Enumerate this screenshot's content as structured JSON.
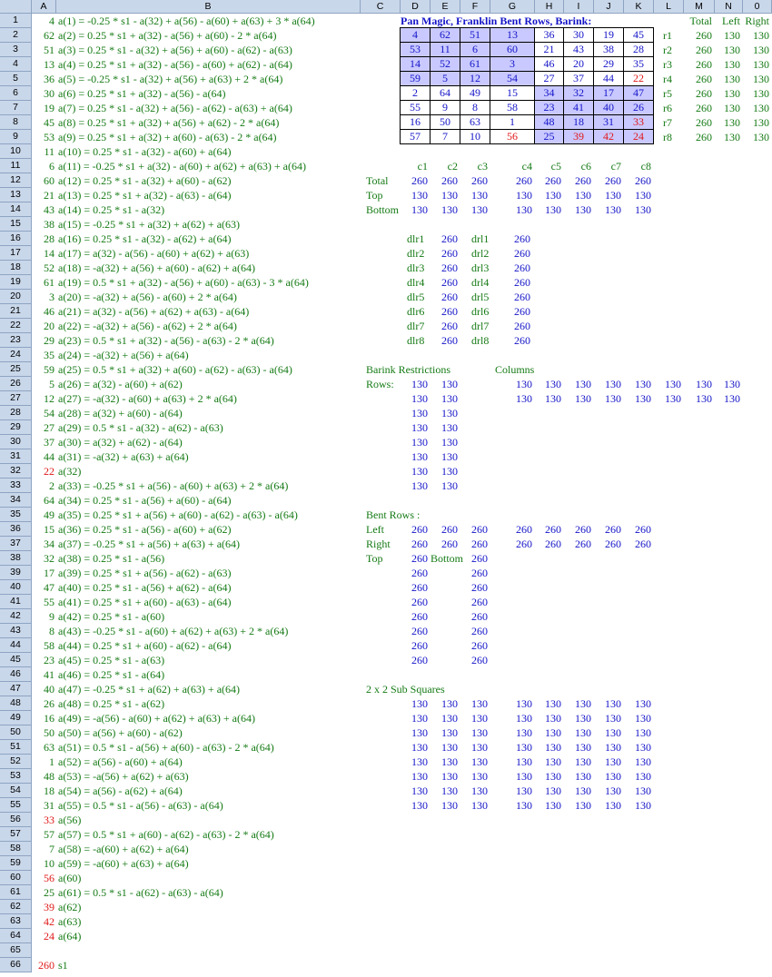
{
  "columns": [
    "A",
    "B",
    "C",
    "D",
    "E",
    "F",
    "G",
    "H",
    "I",
    "J",
    "K",
    "L",
    "M",
    "N",
    "0"
  ],
  "title": "Pan Magic, Franklin Bent Rows, Barink:",
  "hdr_total": "Total",
  "hdr_left": "Left",
  "hdr_right": "Right",
  "square": [
    [
      4,
      62,
      51,
      13,
      36,
      30,
      19,
      45
    ],
    [
      53,
      11,
      6,
      60,
      21,
      43,
      38,
      28
    ],
    [
      14,
      52,
      61,
      3,
      46,
      20,
      29,
      35
    ],
    [
      59,
      5,
      12,
      54,
      27,
      37,
      44,
      22
    ],
    [
      2,
      64,
      49,
      15,
      34,
      32,
      17,
      47
    ],
    [
      55,
      9,
      8,
      58,
      23,
      41,
      40,
      26
    ],
    [
      16,
      50,
      63,
      1,
      48,
      18,
      31,
      33
    ],
    [
      57,
      7,
      10,
      56,
      25,
      39,
      42,
      24
    ]
  ],
  "square_red": [
    [
      3,
      7
    ],
    [
      6,
      7
    ],
    [
      7,
      3
    ],
    [
      7,
      5
    ],
    [
      7,
      6
    ],
    [
      7,
      7
    ]
  ],
  "square_shaded": [
    [
      0,
      0
    ],
    [
      0,
      1
    ],
    [
      0,
      2
    ],
    [
      0,
      3
    ],
    [
      1,
      0
    ],
    [
      1,
      1
    ],
    [
      1,
      2
    ],
    [
      1,
      3
    ],
    [
      2,
      0
    ],
    [
      2,
      1
    ],
    [
      2,
      2
    ],
    [
      2,
      3
    ],
    [
      3,
      0
    ],
    [
      3,
      1
    ],
    [
      3,
      2
    ],
    [
      3,
      3
    ],
    [
      4,
      4
    ],
    [
      4,
      5
    ],
    [
      4,
      6
    ],
    [
      4,
      7
    ],
    [
      5,
      4
    ],
    [
      5,
      5
    ],
    [
      5,
      6
    ],
    [
      5,
      7
    ],
    [
      6,
      4
    ],
    [
      6,
      5
    ],
    [
      6,
      6
    ],
    [
      6,
      7
    ],
    [
      7,
      4
    ],
    [
      7,
      5
    ],
    [
      7,
      6
    ],
    [
      7,
      7
    ]
  ],
  "row_labels": [
    "r1",
    "r2",
    "r3",
    "r4",
    "r5",
    "r6",
    "r7",
    "r8"
  ],
  "row_totals": [
    [
      260,
      130,
      130
    ],
    [
      260,
      130,
      130
    ],
    [
      260,
      130,
      130
    ],
    [
      260,
      130,
      130
    ],
    [
      260,
      130,
      130
    ],
    [
      260,
      130,
      130
    ],
    [
      260,
      130,
      130
    ],
    [
      260,
      130,
      130
    ]
  ],
  "col_labels": [
    "c1",
    "c2",
    "c3",
    "c4",
    "c5",
    "c6",
    "c7",
    "c8"
  ],
  "col_rows": [
    {
      "label": "Total",
      "values": [
        260,
        260,
        260,
        260,
        260,
        260,
        260,
        260
      ]
    },
    {
      "label": "Top",
      "values": [
        130,
        130,
        130,
        130,
        130,
        130,
        130,
        130
      ]
    },
    {
      "label": "Bottom",
      "values": [
        130,
        130,
        130,
        130,
        130,
        130,
        130,
        130
      ]
    }
  ],
  "diagonals": [
    [
      "dlr1",
      260,
      "drl1",
      260
    ],
    [
      "dlr2",
      260,
      "drl2",
      260
    ],
    [
      "dlr3",
      260,
      "drl3",
      260
    ],
    [
      "dlr4",
      260,
      "drl4",
      260
    ],
    [
      "dlr5",
      260,
      "drl5",
      260
    ],
    [
      "dlr6",
      260,
      "drl6",
      260
    ],
    [
      "dlr7",
      260,
      "drl7",
      260
    ],
    [
      "dlr8",
      260,
      "drl8",
      260
    ]
  ],
  "barink_title": "Barink Restrictions",
  "barink_columns_title": "Columns",
  "barink_rows_label": "Rows:",
  "barink_rows": [
    [
      130,
      130
    ],
    [
      130,
      130
    ],
    [
      130,
      130
    ],
    [
      130,
      130
    ],
    [
      130,
      130
    ],
    [
      130,
      130
    ],
    [
      130,
      130
    ],
    [
      130,
      130
    ]
  ],
  "barink_cols": [
    [
      130,
      130,
      130,
      130,
      130,
      130,
      130,
      130
    ],
    [
      130,
      130,
      130,
      130,
      130,
      130,
      130,
      130
    ]
  ],
  "bent_title": "Bent Rows :",
  "bent_left_label": "Left",
  "bent_left": [
    260,
    260,
    260,
    260,
    260,
    260,
    260,
    260
  ],
  "bent_right_label": "Right",
  "bent_right": [
    260,
    260,
    260,
    260,
    260,
    260,
    260,
    260
  ],
  "bent_top_label": "Top",
  "bent_bottom_label": "Bottom",
  "bent_top": [
    260,
    260,
    260,
    260,
    260,
    260,
    260,
    260
  ],
  "bent_bottom": [
    260,
    260,
    260,
    260,
    260,
    260,
    260,
    260
  ],
  "sub_title": "2 x 2 Sub Squares",
  "sub_squares": [
    [
      130,
      130,
      130,
      130,
      130,
      130,
      130,
      130
    ],
    [
      130,
      130,
      130,
      130,
      130,
      130,
      130,
      130
    ],
    [
      130,
      130,
      130,
      130,
      130,
      130,
      130,
      130
    ],
    [
      130,
      130,
      130,
      130,
      130,
      130,
      130,
      130
    ],
    [
      130,
      130,
      130,
      130,
      130,
      130,
      130,
      130
    ],
    [
      130,
      130,
      130,
      130,
      130,
      130,
      130,
      130
    ],
    [
      130,
      130,
      130,
      130,
      130,
      130,
      130,
      130
    ],
    [
      130,
      130,
      130,
      130,
      130,
      130,
      130,
      130
    ]
  ],
  "colA": [
    {
      "v": "4",
      "f": "a(1) = -0.25 * s1 - a(32) + a(56) - a(60) + a(63) + 3 * a(64)"
    },
    {
      "v": "62",
      "f": "a(2) = 0.25 * s1 + a(32) - a(56) + a(60) - 2 * a(64)"
    },
    {
      "v": "51",
      "f": "a(3) = 0.25 * s1 - a(32) + a(56) + a(60) - a(62) - a(63)"
    },
    {
      "v": "13",
      "f": "a(4) = 0.25 * s1 + a(32) - a(56) - a(60) + a(62) - a(64)"
    },
    {
      "v": "36",
      "f": "a(5) = -0.25 * s1 - a(32) + a(56) + a(63) + 2 * a(64)"
    },
    {
      "v": "30",
      "f": "a(6) = 0.25 * s1 + a(32) - a(56) - a(64)"
    },
    {
      "v": "19",
      "f": "a(7) = 0.25 * s1 - a(32) + a(56) - a(62) - a(63) + a(64)"
    },
    {
      "v": "45",
      "f": "a(8) = 0.25 * s1 + a(32) + a(56) + a(62) - 2 * a(64)"
    },
    {
      "v": "53",
      "f": "a(9) = 0.25 * s1 + a(32) + a(60) - a(63) - 2 * a(64)"
    },
    {
      "v": "11",
      "f": "a(10) = 0.25 * s1 - a(32) - a(60) + a(64)"
    },
    {
      "v": "6",
      "f": "a(11) = -0.25 * s1 + a(32) - a(60) + a(62) + a(63) + a(64)"
    },
    {
      "v": "60",
      "f": "a(12) = 0.25 * s1 - a(32) + a(60) - a(62)"
    },
    {
      "v": "21",
      "f": "a(13) = 0.25 * s1 + a(32) - a(63) - a(64)"
    },
    {
      "v": "43",
      "f": "a(14) = 0.25 * s1 - a(32)"
    },
    {
      "v": "38",
      "f": "a(15) = -0.25 * s1 + a(32) + a(62) + a(63)"
    },
    {
      "v": "28",
      "f": "a(16) = 0.25 * s1 - a(32) - a(62) + a(64)"
    },
    {
      "v": "14",
      "f": "a(17) = a(32) - a(56) - a(60) + a(62) + a(63)"
    },
    {
      "v": "52",
      "f": "a(18) = -a(32) + a(56) + a(60) - a(62) + a(64)"
    },
    {
      "v": "61",
      "f": "a(19) = 0.5 * s1 + a(32) - a(56) + a(60) - a(63) - 3 * a(64)"
    },
    {
      "v": "3",
      "f": "a(20) = -a(32) + a(56) - a(60) + 2 * a(64)"
    },
    {
      "v": "46",
      "f": "a(21) = a(32) - a(56) + a(62) + a(63) - a(64)"
    },
    {
      "v": "20",
      "f": "a(22) = -a(32) + a(56) - a(62) + 2 * a(64)"
    },
    {
      "v": "29",
      "f": "a(23) = 0.5 * s1 + a(32) - a(56) - a(63) - 2 * a(64)"
    },
    {
      "v": "35",
      "f": "a(24) = -a(32) + a(56) + a(64)"
    },
    {
      "v": "59",
      "f": "a(25) = 0.5 * s1 + a(32) + a(60) - a(62) - a(63) - a(64)"
    },
    {
      "v": "5",
      "f": "a(26) = a(32) - a(60) + a(62)"
    },
    {
      "v": "12",
      "f": "a(27) = -a(32) - a(60) + a(63) + 2 * a(64)"
    },
    {
      "v": "54",
      "f": "a(28) = a(32) + a(60) - a(64)"
    },
    {
      "v": "27",
      "f": "a(29) = 0.5 * s1 - a(32) - a(62) - a(63)"
    },
    {
      "v": "37",
      "f": "a(30) = a(32) + a(62) - a(64)"
    },
    {
      "v": "44",
      "f": "a(31) = -a(32) + a(63) + a(64)"
    },
    {
      "v": "22",
      "f": "a(32)",
      "red": true
    },
    {
      "v": "2",
      "f": "a(33) = -0.25 * s1 + a(56) - a(60) + a(63) + 2 * a(64)"
    },
    {
      "v": "64",
      "f": "a(34) = 0.25 * s1 - a(56) + a(60) - a(64)"
    },
    {
      "v": "49",
      "f": "a(35) = 0.25 * s1 + a(56) + a(60) - a(62) - a(63) - a(64)"
    },
    {
      "v": "15",
      "f": "a(36) = 0.25 * s1 - a(56) - a(60) + a(62)"
    },
    {
      "v": "34",
      "f": "a(37) = -0.25 * s1 + a(56) + a(63) + a(64)"
    },
    {
      "v": "32",
      "f": "a(38) = 0.25 * s1 - a(56)"
    },
    {
      "v": "17",
      "f": "a(39) = 0.25 * s1 + a(56) - a(62) - a(63)"
    },
    {
      "v": "47",
      "f": "a(40) = 0.25 * s1 - a(56) + a(62) - a(64)"
    },
    {
      "v": "55",
      "f": "a(41) = 0.25 * s1 + a(60) - a(63) - a(64)"
    },
    {
      "v": "9",
      "f": "a(42) = 0.25 * s1 - a(60)"
    },
    {
      "v": "8",
      "f": "a(43) = -0.25 * s1 - a(60) + a(62) + a(63) + 2 * a(64)"
    },
    {
      "v": "58",
      "f": "a(44) = 0.25 * s1 + a(60) - a(62) - a(64)"
    },
    {
      "v": "23",
      "f": "a(45) = 0.25 * s1 - a(63)"
    },
    {
      "v": "41",
      "f": "a(46) = 0.25 * s1 - a(64)"
    },
    {
      "v": "40",
      "f": "a(47) = -0.25 * s1 + a(62) + a(63) + a(64)"
    },
    {
      "v": "26",
      "f": "a(48) = 0.25 * s1 - a(62)"
    },
    {
      "v": "16",
      "f": "a(49) = -a(56) - a(60) + a(62) + a(63) + a(64)"
    },
    {
      "v": "50",
      "f": "a(50) = a(56) + a(60) - a(62)"
    },
    {
      "v": "63",
      "f": "a(51) = 0.5 * s1 - a(56) + a(60) - a(63) - 2 * a(64)"
    },
    {
      "v": "1",
      "f": "a(52) = a(56) - a(60) + a(64)"
    },
    {
      "v": "48",
      "f": "a(53) = -a(56) + a(62) + a(63)"
    },
    {
      "v": "18",
      "f": "a(54) = a(56) - a(62) + a(64)"
    },
    {
      "v": "31",
      "f": "a(55) = 0.5 * s1 - a(56) - a(63) - a(64)"
    },
    {
      "v": "33",
      "f": "a(56)",
      "red": true
    },
    {
      "v": "57",
      "f": "a(57) = 0.5 * s1 + a(60) - a(62) - a(63) - 2 * a(64)"
    },
    {
      "v": "7",
      "f": "a(58) = -a(60) + a(62) + a(64)"
    },
    {
      "v": "10",
      "f": "a(59) = -a(60) + a(63) + a(64)"
    },
    {
      "v": "56",
      "f": "a(60)",
      "red": true
    },
    {
      "v": "25",
      "f": "a(61) = 0.5 * s1 - a(62) - a(63) - a(64)"
    },
    {
      "v": "39",
      "f": "a(62)",
      "red": true
    },
    {
      "v": "42",
      "f": "a(63)",
      "red": true
    },
    {
      "v": "24",
      "f": "a(64)",
      "red": true
    },
    {
      "v": "",
      "f": ""
    },
    {
      "v": "260",
      "f": "s1",
      "red": true
    }
  ]
}
